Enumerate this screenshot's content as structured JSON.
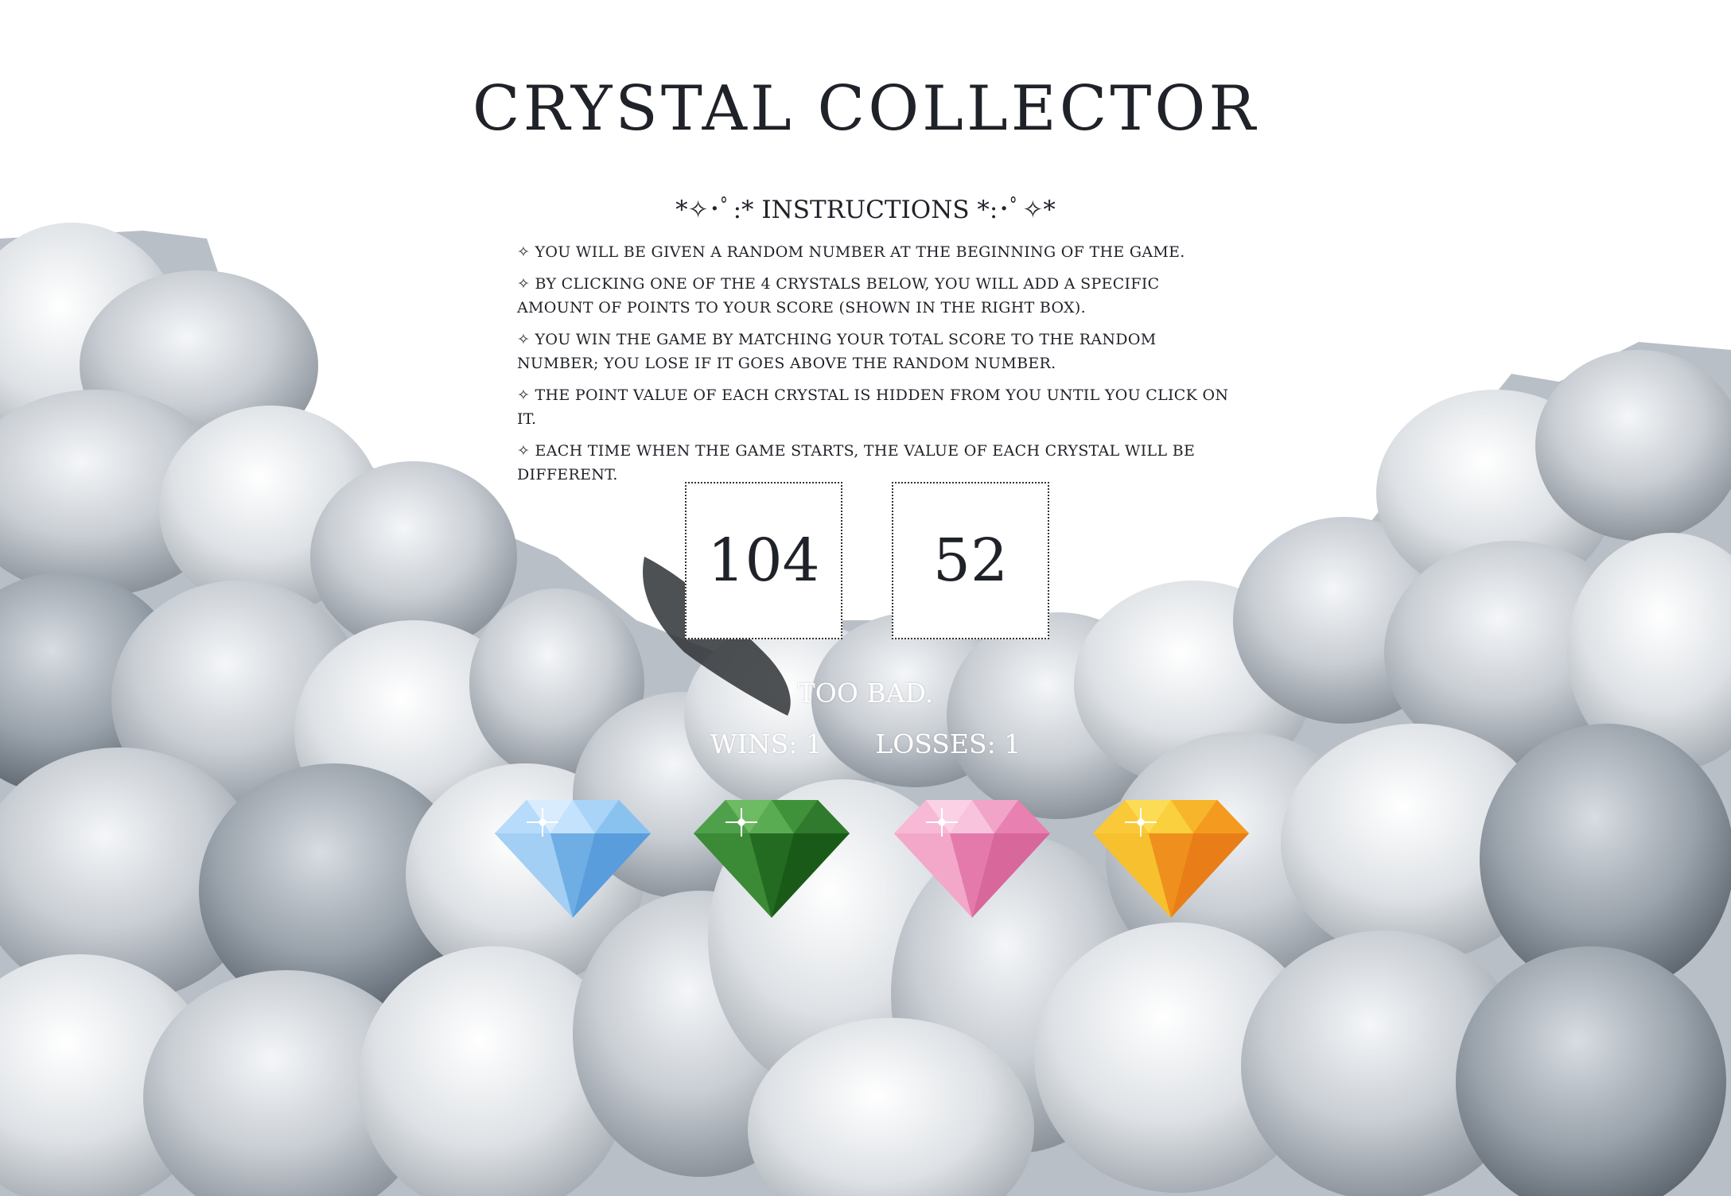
{
  "title": "Crystal Collector",
  "instructions": {
    "heading": "*✧･ﾟ:* Instructions *:･ﾟ✧*",
    "items": [
      "✧ You will be given a random number at the beginning of the game.",
      "✧ By clicking one of the 4 crystals below, you will add a specific amount of points to your score (shown in the right box).",
      "✧ You win the game by matching your total score to the random number; you lose if it goes above the random number.",
      "✧ The point value of each crystal is hidden from you until you click on it.",
      "✧ Each time when the game starts, the value of each crystal will be different."
    ]
  },
  "game": {
    "target_number": "104",
    "current_score": "52",
    "result_message": "Too bad.",
    "wins_label": "Wins: 1",
    "losses_label": "Losses: 1"
  },
  "crystals": [
    {
      "name": "blue-crystal",
      "color": "#8fc4ef"
    },
    {
      "name": "green-crystal",
      "color": "#2e7d2b"
    },
    {
      "name": "pink-crystal",
      "color": "#f19bc4"
    },
    {
      "name": "orange-crystal",
      "color": "#f5a623"
    }
  ],
  "colors": {
    "text": "#1f2228",
    "overlay_text": "#ffffff",
    "background": "#ffffff"
  }
}
